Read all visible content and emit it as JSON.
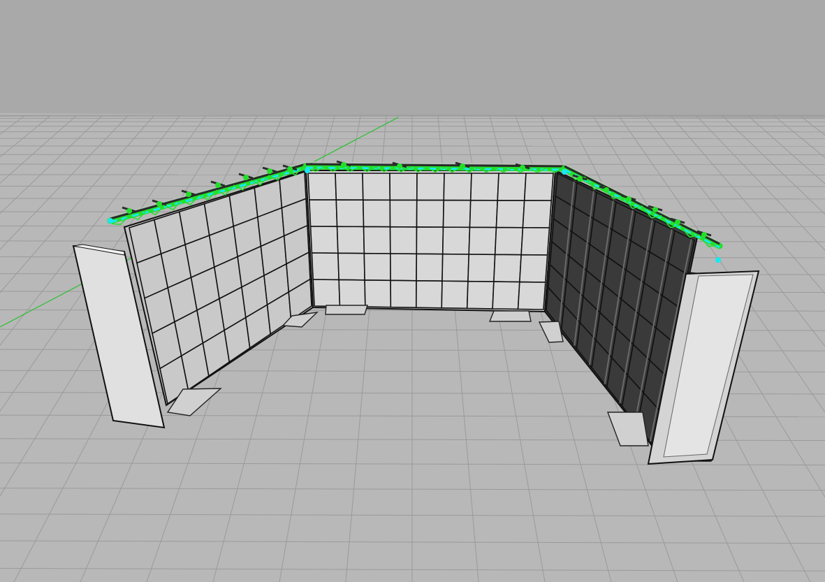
{
  "viewport": {
    "sky_color": "#a9a9a9",
    "ground_color": "#b8b8b8",
    "grid_color": "#9a9a9a",
    "y_axis_color": "#22c02a"
  },
  "model": {
    "name": "booth-wall-u-shape",
    "back_panel_color": "#d6d6d6",
    "left_panel_color": "#c4c4c4",
    "right_panel_color": "#3c3c3c",
    "grid_line_color": "#111111",
    "rail_color": "#2a2a2a",
    "selection_green": "#22e02a",
    "selection_cyan": "#18e8f0",
    "side_panel_color": "#e0e0e0",
    "foot_color": "#d0d0d0",
    "back_wall": {
      "columns": 9,
      "rows": 5
    },
    "left_wall": {
      "columns": 7,
      "rows": 5
    },
    "right_wall": {
      "columns": 7,
      "rows": 6
    }
  },
  "icons": {
    "axis": "y-axis-line",
    "pins": "clamp-pin-icon"
  }
}
